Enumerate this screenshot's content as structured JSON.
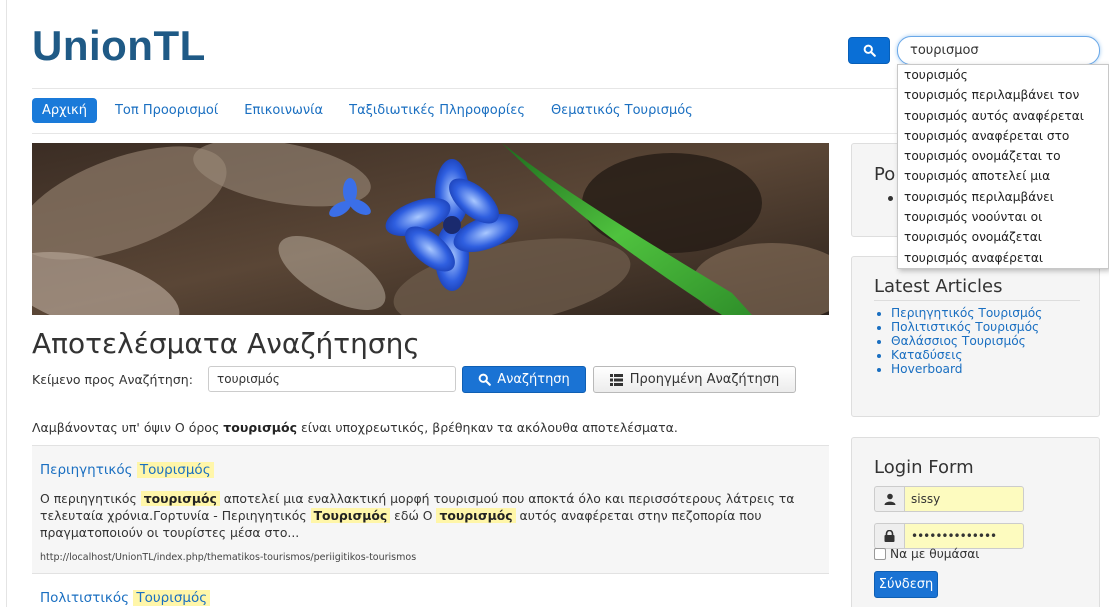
{
  "header": {
    "brand": "UnionTL"
  },
  "search": {
    "value": "τουρισμοσ",
    "suggestions": [
      "τουρισμός",
      "τουρισμός περιλαμβάνει τον",
      "τουρισμός αυτός αναφέρεται",
      "τουρισμός αναφέρεται στο",
      "τουρισμός ονομάζεται το",
      "τουρισμός αποτελεί μια",
      "τουρισμός περιλαμβάνει",
      "τουρισμός νοούνται οι",
      "τουρισμός ονομάζεται",
      "τουρισμός αναφέρεται"
    ]
  },
  "nav": {
    "items": [
      "Αρχική",
      "Τοπ Προορισμοί",
      "Επικοινωνία",
      "Ταξιδιωτικές Πληροφορίες",
      "Θεματικός Τουρισμός"
    ]
  },
  "main": {
    "title": "Αποτελέσματα Αναζήτησης",
    "query_label": "Κείμενο προς Αναζήτηση:",
    "query_value": "τουρισμός",
    "search_button": "Αναζήτηση",
    "advanced_button": "Προηγμένη Αναζήτηση",
    "summary_prefix": "Λαμβάνοντας υπ' όψιν Ο όρος ",
    "summary_term": "τουρισμός",
    "summary_suffix": " είναι υποχρεωτικός, βρέθηκαν τα ακόλουθα αποτελέσματα."
  },
  "results": [
    {
      "title_a": "Περιηγητικός",
      "title_b": "Τουρισμός",
      "text_1": "Ο περιηγητικός ",
      "hl_1": "τουρισμός",
      "text_2": " αποτελεί μια εναλλακτική μορφή τουρισμού που αποκτά όλο και περισσότερους λάτρεις τα τελευταία χρόνια.Γορτυνία - Περιηγητικός ",
      "hl_2": "Τουρισμός",
      "text_3": " εδώ Ο ",
      "hl_3": "τουρισμός",
      "text_4": " αυτός αναφέρεται στην πεζοπορία που πραγματοποιούν οι τουρίστες μέσα στο...",
      "url": "http://localhost/UnionTL/index.php/thematikos-tourismos/periigitikos-tourismos"
    },
    {
      "title_a": "Πολιτιστικός",
      "title_b": "Τουρισμός"
    }
  ],
  "sidebar": {
    "popular_heading_partial": "Po",
    "latest_heading": "Latest Articles",
    "latest_items": [
      "Περιηγητικός Τουρισμός",
      "Πολιτιστικός Τουρισμός",
      "Θαλάσσιος Τουρισμός",
      "Καταδύσεις",
      "Hoverboard"
    ],
    "login": {
      "heading": "Login Form",
      "username": "sissy",
      "password_mask": "••••••••••••••",
      "remember_label": "Να με θυμάσαι",
      "submit": "Σύνδεση"
    }
  }
}
